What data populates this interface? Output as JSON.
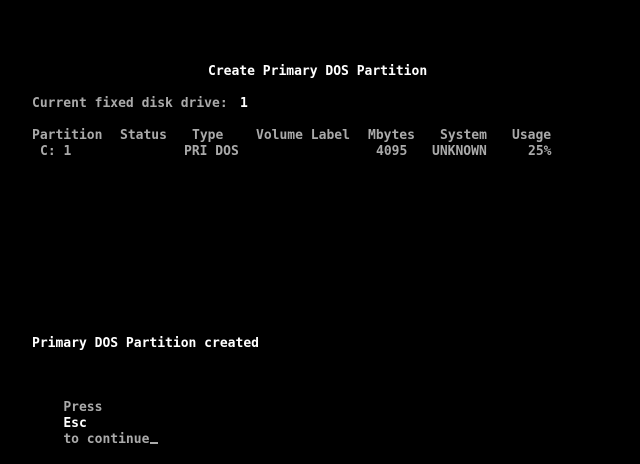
{
  "screen": {
    "title": "Create Primary DOS Partition",
    "drive_label": "Current fixed disk drive:",
    "drive_number": "1",
    "columns": {
      "partition": "Partition",
      "status": "Status",
      "type": "Type",
      "volume_label": "Volume Label",
      "mbytes": "Mbytes",
      "system": "System",
      "usage": "Usage"
    },
    "rows": [
      {
        "partition": "C: 1",
        "status": "",
        "type": "PRI DOS",
        "volume_label": "",
        "mbytes": "4095",
        "system": "UNKNOWN",
        "usage": "25%"
      }
    ],
    "message": "Primary DOS Partition created",
    "prompt_prefix": "Press",
    "prompt_key": "Esc",
    "prompt_suffix": "to continue"
  },
  "colors": {
    "background": "#000000",
    "text": "#AAAAAA",
    "highlight": "#FFFFFF"
  }
}
